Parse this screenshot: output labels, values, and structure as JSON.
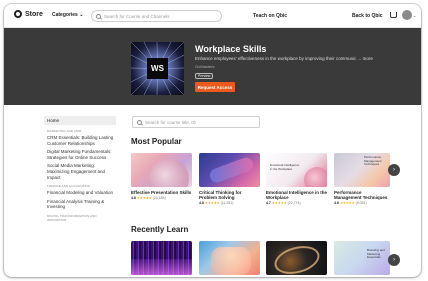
{
  "nav": {
    "logo": "Store",
    "categories": "Categories",
    "search_placeholder": "Search for Course and Channels",
    "teach": "Teach on Qbic",
    "back": "Back to Qbic"
  },
  "hero": {
    "badge": "WS",
    "title": "Workplace Skills",
    "description": "Enhance employees' effectiveness in the workplace by improving their communic ... more",
    "author": "GoMasters",
    "tag": "Preview",
    "button": "Request Access"
  },
  "sidebar": {
    "home": "Home",
    "sections": [
      {
        "title": "MARKETING AND CRM",
        "items": [
          "CRM Essentials: Building Lasting Customer Relationships",
          "Digital Marketing Fundamentals: Strategies for Online Success",
          "Social Media Marketing: Maximizing Engagement and Impact"
        ]
      },
      {
        "title": "FINANCE AND ACCOUNTING",
        "items": [
          "Financial Modeling and Valuation",
          "Financial Analysis Training & Investing"
        ]
      },
      {
        "title": "DIGITAL TRANSFORMATION AND INNOVATION",
        "items": []
      }
    ]
  },
  "main": {
    "search_placeholder": "Search for course title, ID",
    "most_popular_title": "Most Popular",
    "recently_learn_title": "Recently Learn",
    "popular_cards": [
      {
        "title": "Effective Presentation Skills",
        "score": "4.8",
        "stars": "★★★★★",
        "count": "(24,188)"
      },
      {
        "title": "Critical Thinking for Problem Solving",
        "score": "4.8",
        "stars": "★★★★★",
        "count": "(11,251)"
      },
      {
        "title": "Emotional Intelligence in the Workplace",
        "score": "4.7",
        "stars": "★★★★★",
        "count": "(22,774)"
      },
      {
        "title": "Performance Management Techniques",
        "score": "4.6",
        "stars": "★★★★★",
        "count": "(9,051)"
      }
    ],
    "card3_thumb_text": "Emotional Intelligence in the Workplace",
    "card4_thumb_text": "Performance Management Techniques",
    "recent_card4_thumb_text": "Branding and Marketing Essentials",
    "next_arrow": "›"
  }
}
